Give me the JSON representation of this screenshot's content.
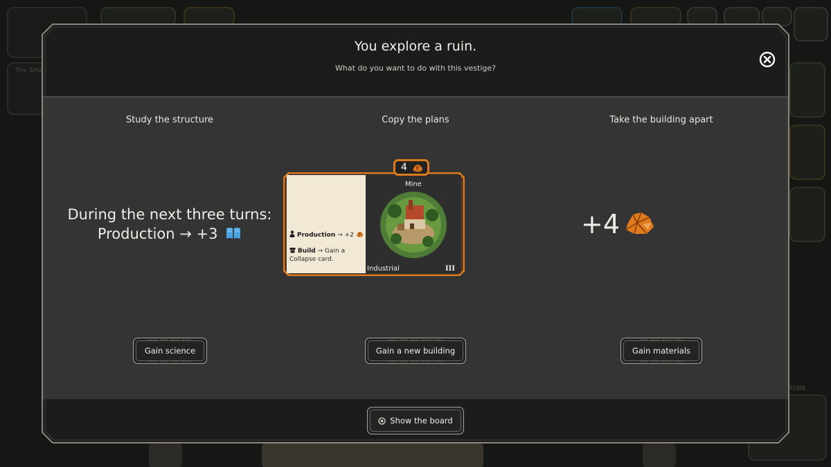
{
  "modal": {
    "title": "You explore a ruin.",
    "subtitle": "What do you want to do with this vestige?"
  },
  "options": [
    {
      "title": "Study the structure",
      "description_line1": "During the next three turns:",
      "description_line2": "Production → +3",
      "button": "Gain science"
    },
    {
      "title": "Copy the plans",
      "button": "Gain a new building"
    },
    {
      "title": "Take the building apart",
      "amount": "+4",
      "button": "Gain materials"
    }
  ],
  "card": {
    "cost": "4",
    "name": "Mine",
    "type": "Industrial",
    "tier": "III",
    "effect1_label": "Production",
    "effect1_value": "→ +2",
    "effect2_label": "Build",
    "effect2_value": "→ Gain a Collapse card."
  },
  "footer": {
    "show_board": "Show the board"
  },
  "background": {
    "side_text": "The Sma",
    "ruin_label": "RUIN"
  },
  "colors": {
    "accent_orange": "#e07a1f",
    "science_blue": "#4aa3e0",
    "panel_gray": "#343434"
  },
  "icons": {
    "close": "close-circle-icon",
    "science": "book-icon",
    "materials": "ore-icon",
    "board": "close-small-icon"
  }
}
